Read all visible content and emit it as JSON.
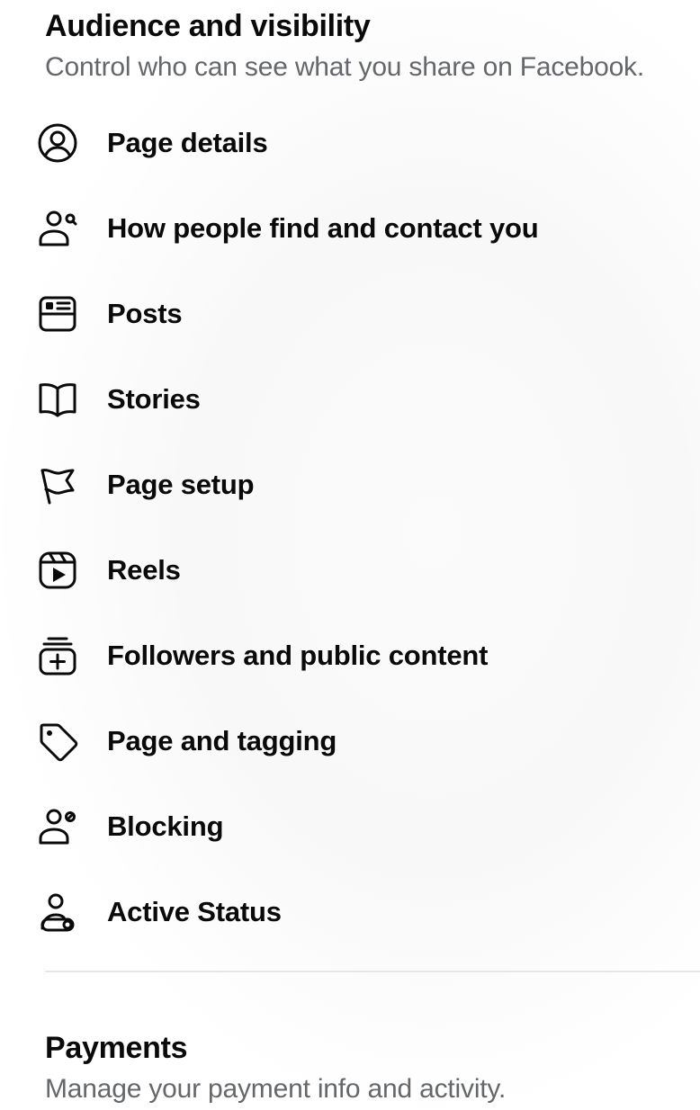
{
  "audience_section": {
    "title": "Audience and visibility",
    "subtitle": "Control who can see what you share on Facebook.",
    "items": [
      {
        "label": "Page details",
        "icon": "profile-circle-icon"
      },
      {
        "label": "How people find and contact you",
        "icon": "person-search-icon"
      },
      {
        "label": "Posts",
        "icon": "post-card-icon"
      },
      {
        "label": "Stories",
        "icon": "book-icon"
      },
      {
        "label": "Page setup",
        "icon": "flag-icon"
      },
      {
        "label": "Reels",
        "icon": "reels-play-icon"
      },
      {
        "label": "Followers and public content",
        "icon": "followers-plus-icon"
      },
      {
        "label": "Page and tagging",
        "icon": "tag-icon"
      },
      {
        "label": "Blocking",
        "icon": "person-block-icon"
      },
      {
        "label": "Active Status",
        "icon": "person-toggle-icon"
      }
    ]
  },
  "payments_section": {
    "title": "Payments",
    "subtitle": "Manage your payment info and activity."
  }
}
